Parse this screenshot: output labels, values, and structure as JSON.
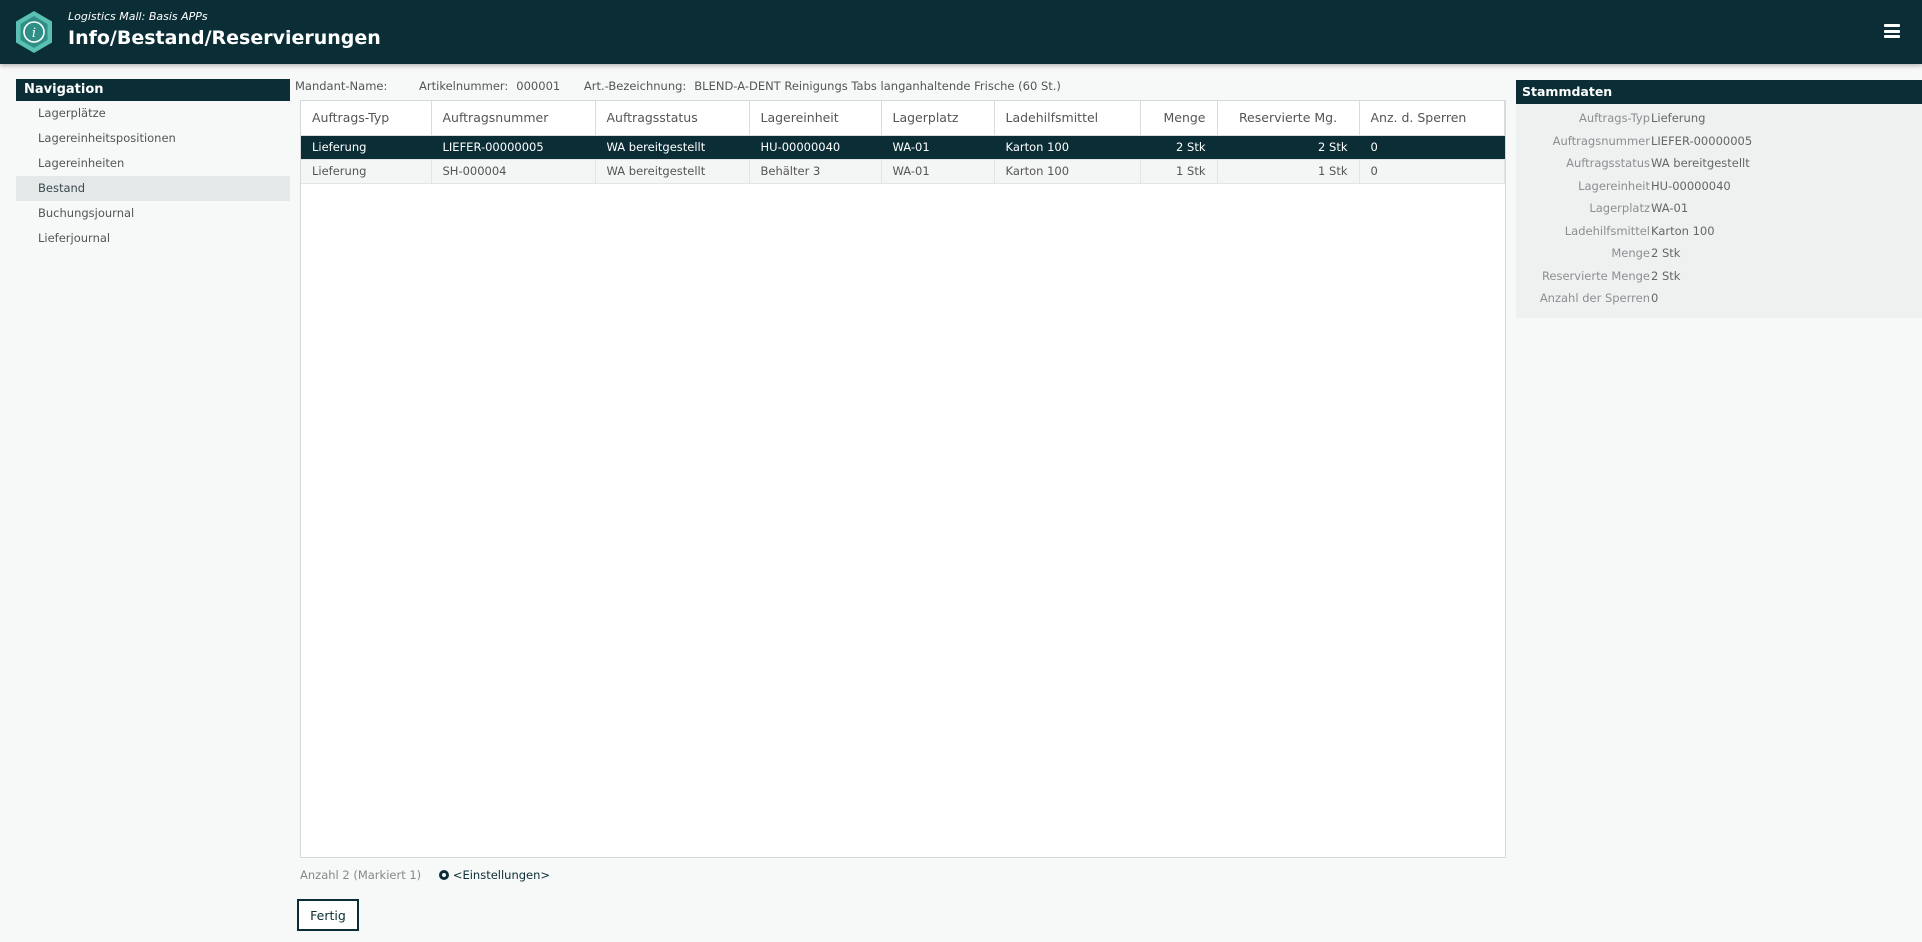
{
  "header": {
    "subtitle": "Logistics Mall: Basis APPs",
    "title": "Info/Bestand/Reservierungen"
  },
  "navigation": {
    "title": "Navigation",
    "items": [
      {
        "label": "Lagerplätze"
      },
      {
        "label": "Lagereinheitspositionen"
      },
      {
        "label": "Lagereinheiten"
      },
      {
        "label": "Bestand",
        "active": true
      },
      {
        "label": "Buchungsjournal"
      },
      {
        "label": "Lieferjournal"
      }
    ]
  },
  "meta": {
    "mandant_label": "Mandant-Name:",
    "mandant_value": "",
    "artikelnummer_label": "Artikelnummer:",
    "artikelnummer_value": "000001",
    "bezeichnung_label": "Art.-Bezeichnung:",
    "bezeichnung_value": "BLEND-A-DENT Reinigungs Tabs langanhaltende Frische (60 St.)"
  },
  "table": {
    "columns": [
      "Auftrags-Typ",
      "Auftragsnummer",
      "Auftragsstatus",
      "Lagereinheit",
      "Lagerplatz",
      "Ladehilfsmittel",
      "Menge",
      "Reservierte Mg.",
      "Anz. d. Sperren"
    ],
    "rows": [
      [
        "Lieferung",
        "LIEFER-00000005",
        "WA bereitgestellt",
        "HU-00000040",
        "WA-01",
        "Karton 100",
        "2 Stk",
        "2 Stk",
        "0"
      ],
      [
        "Lieferung",
        "SH-000004",
        "WA bereitgestellt",
        "Behälter 3",
        "WA-01",
        "Karton 100",
        "1 Stk",
        "1 Stk",
        "0"
      ]
    ],
    "selected_row": 0
  },
  "footer": {
    "count_text": "Anzahl 2 (Markiert 1)",
    "settings_label": "<Einstellungen>",
    "done_button": "Fertig"
  },
  "stammdaten": {
    "title": "Stammdaten",
    "fields": [
      {
        "label": "Auftrags-Typ",
        "value": "Lieferung"
      },
      {
        "label": "Auftragsnummer",
        "value": "LIEFER-00000005"
      },
      {
        "label": "Auftragsstatus",
        "value": "WA bereitgestellt"
      },
      {
        "label": "Lagereinheit",
        "value": "HU-00000040"
      },
      {
        "label": "Lagerplatz",
        "value": "WA-01"
      },
      {
        "label": "Ladehilfsmittel",
        "value": "Karton 100"
      },
      {
        "label": "Menge",
        "value": "2 Stk"
      },
      {
        "label": "Reservierte Menge",
        "value": "2 Stk"
      },
      {
        "label": "Anzahl der Sperren",
        "value": "0"
      }
    ]
  },
  "colors": {
    "primary": "#0b2e36",
    "accent": "#5bc0b4"
  }
}
